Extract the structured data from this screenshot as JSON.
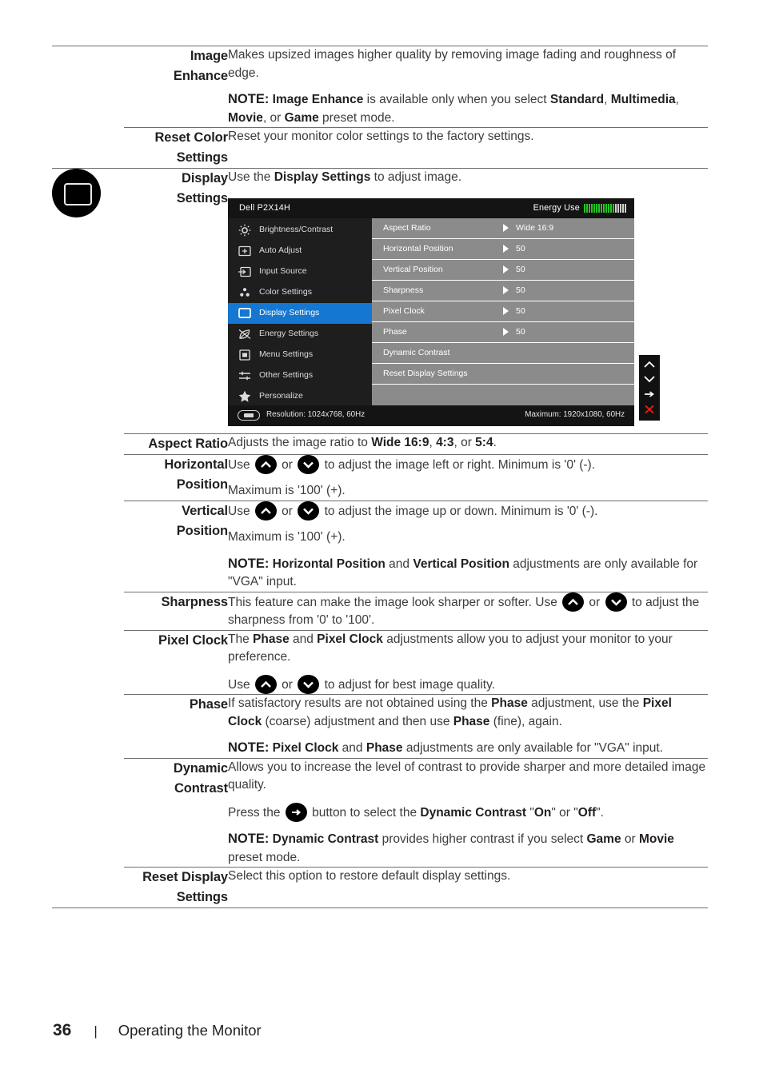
{
  "document": {
    "footer": {
      "page_number": "36",
      "separator": "|",
      "title": "Operating the Monitor"
    }
  },
  "rows": {
    "image_enhance": {
      "name_line1": "Image",
      "name_line2": "Enhance",
      "desc_p1": "Makes upsized images higher quality by removing image fading and roughness of edge.",
      "note_label": "NOTE:",
      "note_b1": "Image Enhance",
      "note_t1": " is available only when you select ",
      "note_b2": "Standard",
      "note_t2": ", ",
      "note_b3": "Multimedia",
      "note_t3": ", ",
      "note_b4": "Movie",
      "note_t4": ", or ",
      "note_b5": "Game",
      "note_t5": " preset mode."
    },
    "reset_color_settings": {
      "name_line1": "Reset Color",
      "name_line2": "Settings",
      "desc_p1": "Reset your monitor color settings to the factory settings."
    },
    "display_settings": {
      "name_line1": "Display",
      "name_line2": "Settings",
      "desc_pre": "Use the ",
      "desc_bold": "Display Settings",
      "desc_post": " to adjust image.",
      "icon": "display-monitor-icon"
    },
    "aspect_ratio": {
      "name": "Aspect Ratio",
      "t1": "Adjusts the image ratio to ",
      "b1": "Wide 16:9",
      "t2": ", ",
      "b2": "4:3",
      "t3": ", or ",
      "b3": "5:4",
      "t4": "."
    },
    "horizontal_position": {
      "name_line1": "Horizontal",
      "name_line2": "Position",
      "t1": "Use ",
      "t2": " or ",
      "t3": " to adjust the image left or right. Minimum is '0' (-).",
      "t4": "Maximum is '100' (+)."
    },
    "vertical_position": {
      "name_line1": "Vertical",
      "name_line2": "Position",
      "t1": "Use ",
      "t2": " or ",
      "t3": " to adjust the image up or down. Minimum is '0' (-).",
      "t4": "Maximum is '100' (+).",
      "note_label": "NOTE:",
      "note_b1": "Horizontal Position",
      "note_t1": " and ",
      "note_b2": "Vertical Position",
      "note_t2": " adjustments are only available for \"VGA\" input."
    },
    "sharpness": {
      "name": "Sharpness",
      "t1": "This feature can make the image look sharper or softer. Use ",
      "t2": " or ",
      "t3": " to adjust the sharpness from '0' to '100'."
    },
    "pixel_clock": {
      "name_line1": "Pixel Clock",
      "t1": "The ",
      "b1": "Phase",
      "t2": " and ",
      "b2": "Pixel Clock",
      "t3": " adjustments allow you to adjust your monitor to your preference.",
      "t4": "Use ",
      "t5": " or ",
      "t6": " to adjust for best image quality."
    },
    "phase": {
      "name": "Phase",
      "t1": "If satisfactory results are not obtained using the ",
      "b1": "Phase",
      "t2": " adjustment, use the ",
      "b2": "Pixel Clock",
      "t3": " (coarse) adjustment and then use ",
      "b3": "Phase",
      "t4": " (fine), again.",
      "note_label": "NOTE:",
      "note_b1": "Pixel Clock",
      "note_t1": " and ",
      "note_b2": "Phase",
      "note_t2": " adjustments are only available for \"VGA\" input."
    },
    "dynamic_contrast": {
      "name_line1": "Dynamic",
      "name_line2": "Contrast",
      "t1": "Allows you to increase the level of contrast to provide sharper and more detailed image quality.",
      "t2": "Press the ",
      "t3": " button to select the ",
      "b1": "Dynamic Contrast",
      "t4": " \"",
      "b2": "On",
      "t5": "\" or \"",
      "b3": "Off",
      "t6": "\".",
      "note_label": "NOTE:",
      "note_b1": "Dynamic Contrast",
      "note_t1": " provides higher contrast if you select ",
      "note_b2": "Game",
      "note_t2": " or ",
      "note_b3": "Movie",
      "note_t3": " preset mode."
    },
    "reset_display_settings": {
      "name_line1": "Reset Display",
      "name_line2": "Settings",
      "desc_p1": "Select this option to restore default display settings."
    }
  },
  "osd": {
    "title": "Dell P2X14H",
    "energy_label": "Energy Use",
    "energy_bars_on": 13,
    "energy_bars_off": 5,
    "menu_items": [
      {
        "label": "Brightness/Contrast",
        "icon": "brightness-icon",
        "selected": false
      },
      {
        "label": "Auto Adjust",
        "icon": "auto-adjust-icon",
        "selected": false
      },
      {
        "label": "Input Source",
        "icon": "input-source-icon",
        "selected": false
      },
      {
        "label": "Color Settings",
        "icon": "color-settings-icon",
        "selected": false
      },
      {
        "label": "Display Settings",
        "icon": "display-settings-icon",
        "selected": true
      },
      {
        "label": "Energy Settings",
        "icon": "energy-settings-icon",
        "selected": false
      },
      {
        "label": "Menu Settings",
        "icon": "menu-settings-icon",
        "selected": false
      },
      {
        "label": "Other Settings",
        "icon": "other-settings-icon",
        "selected": false
      },
      {
        "label": "Personalize",
        "icon": "personalize-star-icon",
        "selected": false
      }
    ],
    "options": [
      {
        "label": "Aspect Ratio",
        "value": "Wide 16:9",
        "arrow": true
      },
      {
        "label": "Horizontal Position",
        "value": "50",
        "arrow": true
      },
      {
        "label": "Vertical Position",
        "value": "50",
        "arrow": true
      },
      {
        "label": "Sharpness",
        "value": "50",
        "arrow": true
      },
      {
        "label": "Pixel Clock",
        "value": "50",
        "arrow": true
      },
      {
        "label": "Phase",
        "value": "50",
        "arrow": true
      },
      {
        "label": "Dynamic Contrast",
        "value": "",
        "arrow": false
      },
      {
        "label": "Reset Display Settings",
        "value": "",
        "arrow": false
      }
    ],
    "footer_resolution": "Resolution: 1024x768, 60Hz",
    "footer_maximum": "Maximum: 1920x1080, 60Hz",
    "nav_icons": [
      "up-arrow-icon",
      "down-arrow-icon",
      "right-arrow-icon",
      "close-x-icon"
    ],
    "colors": {
      "selected_blue": "#1477d1",
      "panel_gray": "#8b8b8b",
      "sidebar_dark": "#1e1e1e",
      "header_black": "#141414",
      "energy_green": "#24c424",
      "close_red": "#e01b16"
    }
  }
}
